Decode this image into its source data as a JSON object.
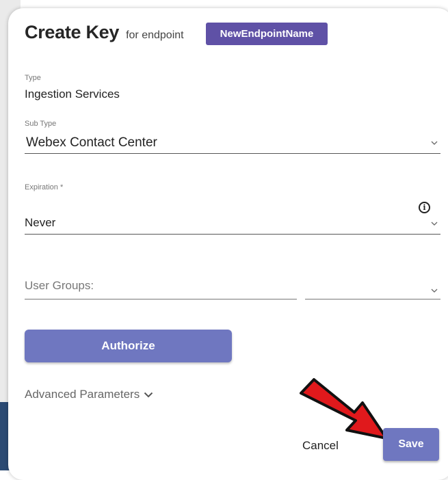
{
  "dialog": {
    "title": "Create Key",
    "subtitle": "for endpoint",
    "endpoint_badge": "NewEndpointName"
  },
  "fields": {
    "type": {
      "label": "Type",
      "value": "Ingestion Services"
    },
    "sub_type": {
      "label": "Sub Type",
      "value": "Webex Contact Center"
    },
    "expiration": {
      "label": "Expiration *",
      "value": "Never"
    },
    "user_groups": {
      "placeholder": "User Groups:"
    }
  },
  "buttons": {
    "authorize": "Authorize",
    "advanced": "Advanced Parameters",
    "cancel": "Cancel",
    "save": "Save"
  },
  "icons": {
    "info": "info-icon",
    "chevron": "chevron-down-icon",
    "annotation": "red-arrow-icon"
  },
  "colors": {
    "badge": "#5f51a6",
    "primary_button": "#6f77c0",
    "arrow": "#e0191c"
  }
}
